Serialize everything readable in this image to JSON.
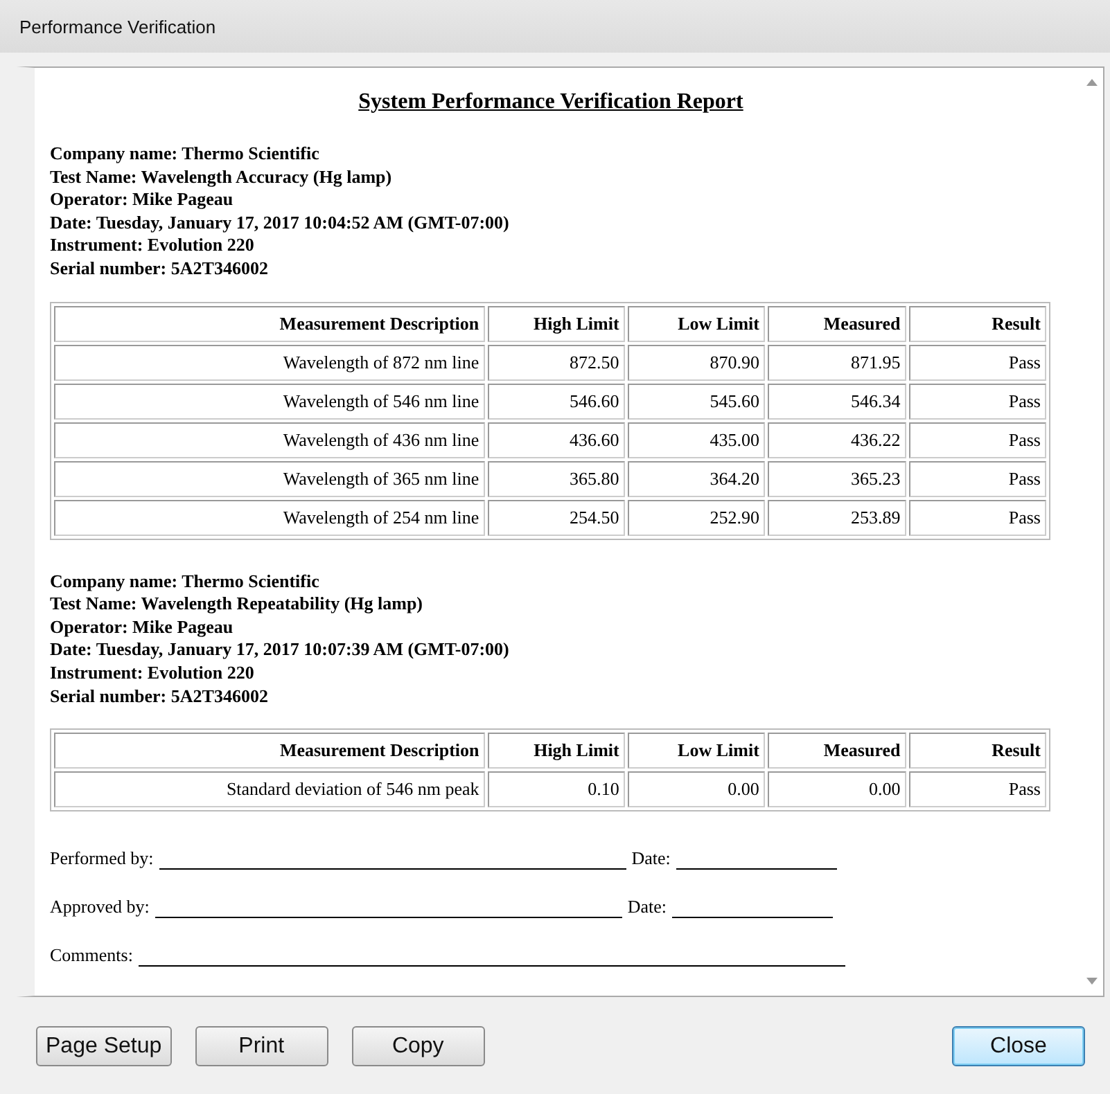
{
  "window": {
    "title": "Performance Verification"
  },
  "report": {
    "title": "System Performance Verification Report",
    "sections": [
      {
        "info": [
          "Company name: Thermo Scientific",
          "Test Name: Wavelength Accuracy (Hg lamp)",
          "Operator: Mike Pageau",
          "Date: Tuesday, January 17, 2017 10:04:52 AM (GMT-07:00)",
          "Instrument: Evolution 220",
          "Serial number: 5A2T346002"
        ],
        "table": {
          "columns": [
            "Measurement Description",
            "High Limit",
            "Low Limit",
            "Measured",
            "Result"
          ],
          "rows": [
            [
              "Wavelength of 872 nm line",
              "872.50",
              "870.90",
              "871.95",
              "Pass"
            ],
            [
              "Wavelength of 546 nm line",
              "546.60",
              "545.60",
              "546.34",
              "Pass"
            ],
            [
              "Wavelength of 436 nm line",
              "436.60",
              "435.00",
              "436.22",
              "Pass"
            ],
            [
              "Wavelength of 365 nm line",
              "365.80",
              "364.20",
              "365.23",
              "Pass"
            ],
            [
              "Wavelength of 254 nm line",
              "254.50",
              "252.90",
              "253.89",
              "Pass"
            ]
          ]
        }
      },
      {
        "info": [
          "Company name: Thermo Scientific",
          "Test Name: Wavelength Repeatability (Hg lamp)",
          "Operator: Mike Pageau",
          "Date: Tuesday, January 17, 2017 10:07:39 AM (GMT-07:00)",
          "Instrument: Evolution 220",
          "Serial number: 5A2T346002"
        ],
        "table": {
          "columns": [
            "Measurement Description",
            "High Limit",
            "Low Limit",
            "Measured",
            "Result"
          ],
          "rows": [
            [
              "Standard deviation of 546 nm peak",
              "0.10",
              "0.00",
              "0.00",
              "Pass"
            ]
          ]
        }
      }
    ],
    "signatures": [
      {
        "label": "Performed by:",
        "date_label": "Date:"
      },
      {
        "label": "Approved by:",
        "date_label": "Date:"
      },
      {
        "label": "Comments:"
      }
    ]
  },
  "buttons": [
    {
      "label": "Page Setup",
      "default": false
    },
    {
      "label": "Print",
      "default": false
    },
    {
      "label": "Copy",
      "default": false
    },
    {
      "label": "Close",
      "default": true
    }
  ]
}
